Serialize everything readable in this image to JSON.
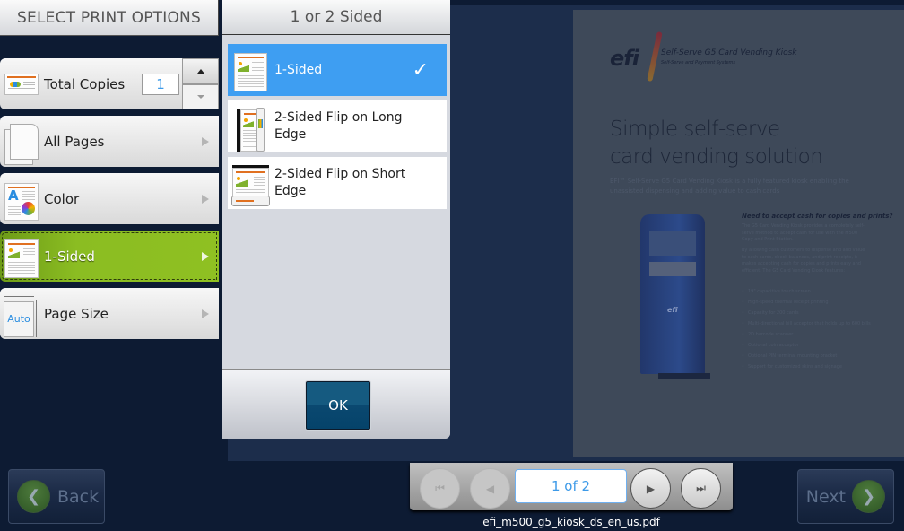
{
  "left_panel": {
    "title": "SELECT PRINT OPTIONS",
    "total_copies": {
      "label": "Total Copies",
      "value": "1"
    },
    "options": [
      {
        "label": "All Pages",
        "icon": "pages-icon"
      },
      {
        "label": "Color",
        "icon": "color-icon"
      },
      {
        "label": "1-Sided",
        "icon": "one-sided-icon",
        "active": true
      },
      {
        "label": "Page Size",
        "icon": "page-size-icon",
        "icon_text": "Auto"
      }
    ]
  },
  "dialog": {
    "title": "1 or 2 Sided",
    "choices": [
      {
        "label": "1-Sided",
        "selected": true
      },
      {
        "label": "2-Sided Flip on Long Edge",
        "selected": false
      },
      {
        "label": "2-Sided Flip on Short Edge",
        "selected": false
      }
    ],
    "ok_label": "OK",
    "check_glyph": "✓"
  },
  "preview": {
    "logo": "efi",
    "product": "Self-Serve G5 Card Vending Kiosk",
    "product_sub": "Self-Serve and Payment Systems",
    "headline_1": "Simple self-serve",
    "headline_2": "card vending solution",
    "intro": "EFI™ Self-Serve G5 Card Vending Kiosk is a fully featured kiosk enabling the unassisted dispensing and adding value to cash cards",
    "question": "Need to accept cash for copies and prints?",
    "para_1": "The G5 Card Vending Kiosk provides a completely self-serve method to accept cash for use with the M500 Copy and Print Station.",
    "para_2": "By allowing cash customers to dispense and add value to cash cards, check balances, and print receipts, it makes accepting cash for copies and prints easy and efficient. The G5 Card Vending Kiosk features:",
    "bullets": [
      "19\" capacitive touch screen",
      "High-speed thermal receipt printing",
      "Capacity for 200 cards",
      "Multi-directional bill acceptor that holds up to 600 bills",
      "2D barcode scanner",
      "Optional coin acceptor",
      "Optional PIN terminal mounting bracket",
      "Support for customized skins and signage"
    ],
    "kiosk_brand": "efi"
  },
  "nav": {
    "back_label": "Back",
    "next_label": "Next",
    "page_indicator": "1 of 2",
    "filename": "efi_m500_g5_kiosk_ds_en_us.pdf"
  }
}
